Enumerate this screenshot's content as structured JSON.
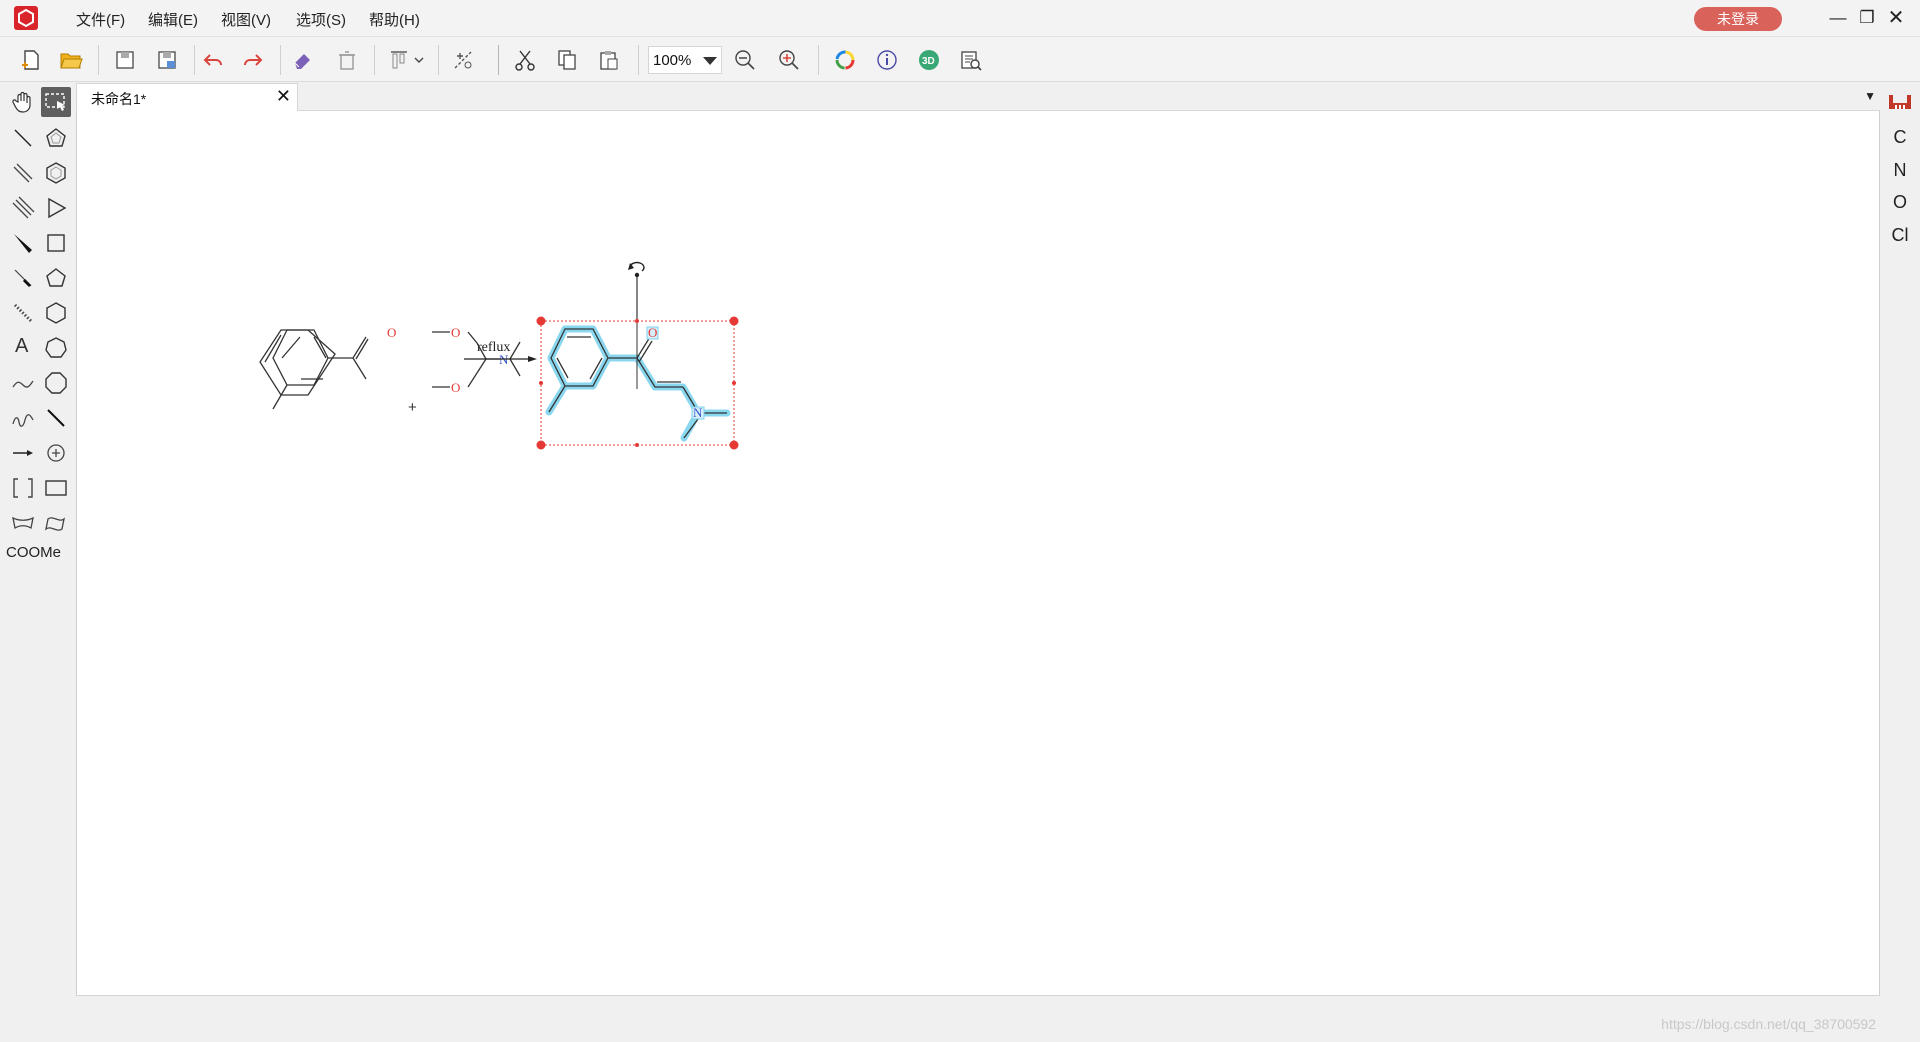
{
  "menu": {
    "file": "文件(F)",
    "edit": "编辑(E)",
    "view": "视图(V)",
    "options": "选项(S)",
    "help": "帮助(H)"
  },
  "login_label": "未登录",
  "zoom": "100%",
  "tab": {
    "title": "未命名1*"
  },
  "left_palette": {
    "text_tool": "A",
    "group_label": "COOMe"
  },
  "right_palette": {
    "elements": [
      "C",
      "N",
      "O",
      "Cl"
    ]
  },
  "reaction": {
    "reactant1": {
      "atoms": [
        "O"
      ]
    },
    "plus": "+",
    "reactant2": {
      "atoms": [
        "O",
        "O",
        "N"
      ]
    },
    "arrow_label": "reflux",
    "product": {
      "atoms": [
        "O",
        "N"
      ]
    }
  },
  "watermark": "https://blog.csdn.net/qq_38700592",
  "colors": {
    "logo": "#d9242b",
    "login": "#d9625a",
    "selection": "#e53935",
    "highlight": "#7dd3ee",
    "oxygen": "#e53935",
    "nitrogen": "#3355cc"
  }
}
